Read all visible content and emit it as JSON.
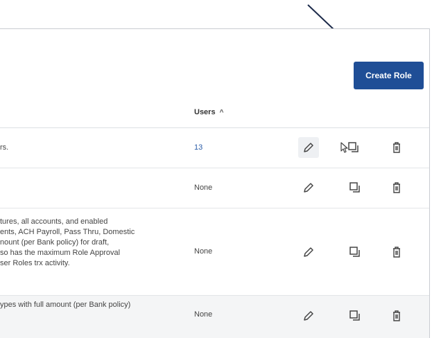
{
  "toolbar": {
    "create_role_label": "Create Role"
  },
  "table": {
    "columns": {
      "users": "Users"
    },
    "rows": [
      {
        "desc": [
          "rs."
        ],
        "users": "13"
      },
      {
        "desc": [],
        "users": "None"
      },
      {
        "desc": [
          "tures, all accounts, and enabled",
          "ents, ACH Payroll, Pass Thru, Domestic",
          "nount (per Bank policy) for draft,",
          "so has the maximum Role Approval",
          "ser Roles trx activity."
        ],
        "users": "None"
      },
      {
        "desc": [
          "ypes with full amount (per Bank policy)"
        ],
        "users": "None"
      }
    ]
  },
  "icons": {
    "edit": "pencil-icon",
    "copy": "copy-icon",
    "delete": "trash-icon",
    "sort": "chevron-up-icon",
    "annotation": "arrow-icon"
  },
  "colors": {
    "accent": "#1f4e96",
    "link": "#2a5ca8",
    "annotation_arrow": "#1c2a4a"
  }
}
